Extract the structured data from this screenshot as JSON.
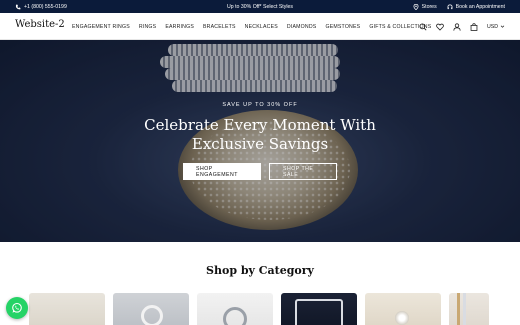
{
  "topbar": {
    "phone": "+1 (800) 555-0199",
    "promo": "Up to 30% Off* Select Styles",
    "stores": "Stores",
    "appointment": "Book an Appointment"
  },
  "header": {
    "logo": "Website-2",
    "nav": [
      "ENGAGEMENT RINGS",
      "RINGS",
      "EARRINGS",
      "BRACELETS",
      "NECKLACES",
      "DIAMONDS",
      "GEMSTONES",
      "GIFTS & COLLECTIONS"
    ],
    "currency": "USD"
  },
  "hero": {
    "kicker": "SAVE UP TO 30% OFF",
    "title_line1": "Celebrate Every Moment With",
    "title_line2": "Exclusive Savings",
    "primary_button": "SHOP ENGAGEMENT",
    "secondary_button": "SHOP THE SALE"
  },
  "categories": {
    "title": "Shop by Category"
  },
  "colors": {
    "topbar_bg": "#0b1b3a",
    "hero_bg": "#1e2a45",
    "whatsapp": "#25d366"
  }
}
